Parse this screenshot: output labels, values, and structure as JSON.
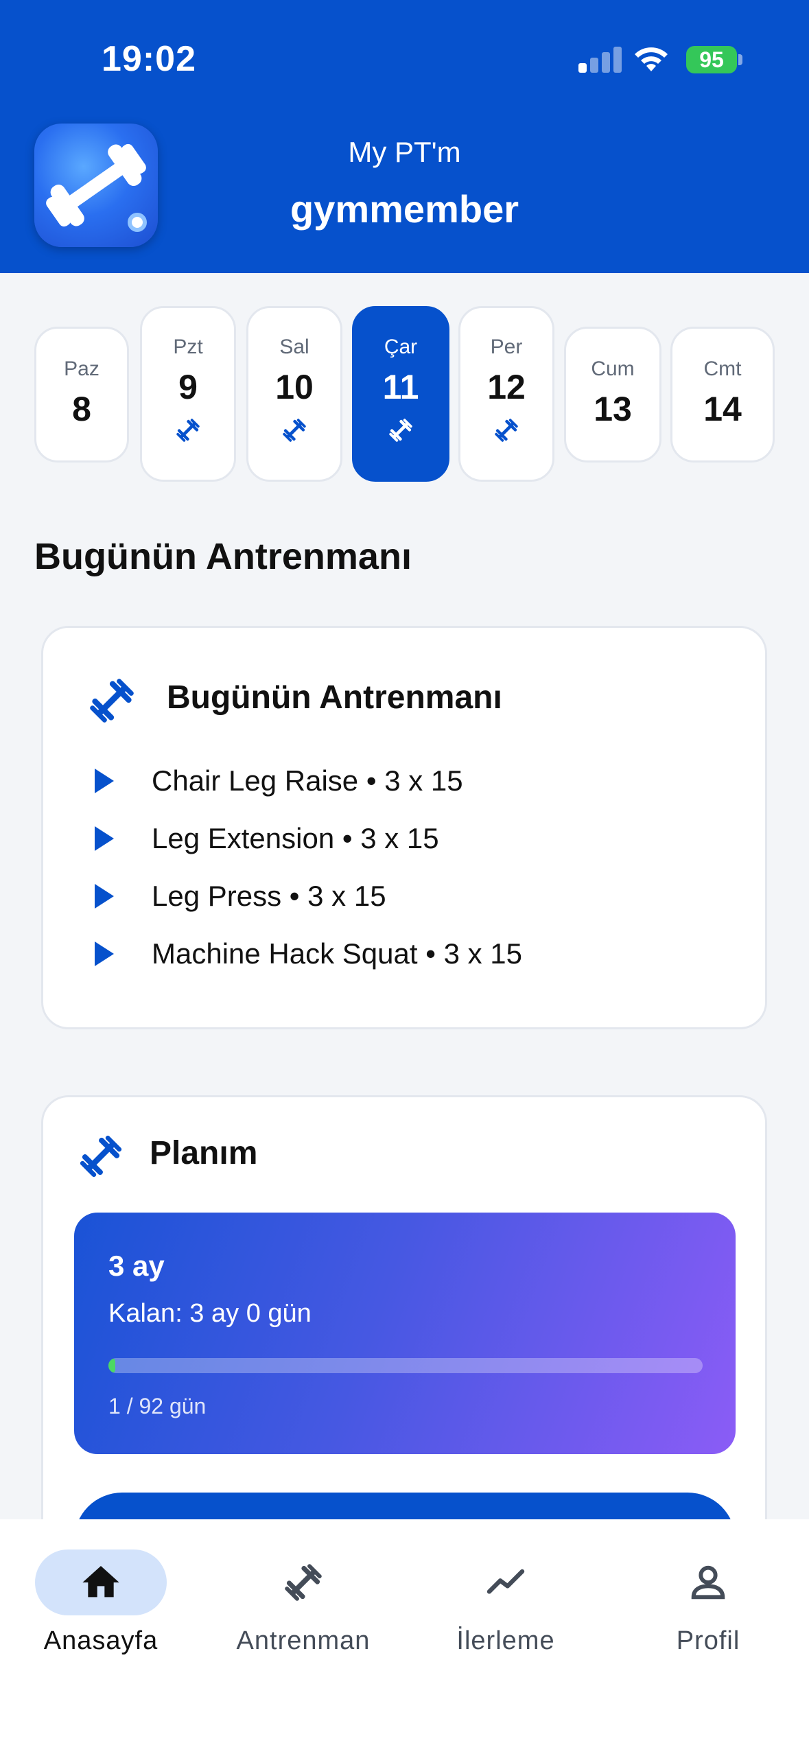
{
  "status_bar": {
    "time": "19:02",
    "battery": "95"
  },
  "header": {
    "app_title": "My PT'm",
    "username": "gymmember"
  },
  "days": [
    {
      "name": "Paz",
      "number": "8",
      "has_workout": false,
      "active": false
    },
    {
      "name": "Pzt",
      "number": "9",
      "has_workout": true,
      "active": false
    },
    {
      "name": "Sal",
      "number": "10",
      "has_workout": true,
      "active": false
    },
    {
      "name": "Çar",
      "number": "11",
      "has_workout": true,
      "active": true
    },
    {
      "name": "Per",
      "number": "12",
      "has_workout": true,
      "active": false
    },
    {
      "name": "Cum",
      "number": "13",
      "has_workout": false,
      "active": false
    },
    {
      "name": "Cmt",
      "number": "14",
      "has_workout": false,
      "active": false
    }
  ],
  "section_title": "Bugünün Antrenmanı",
  "today_card": {
    "title": "Bugünün Antrenmanı",
    "icon": "dumbbell-icon",
    "items": [
      "Chair Leg Raise • 3 x 15",
      "Leg Extension • 3 x 15",
      "Leg Press • 3 x 15",
      "Machine Hack Squat • 3 x 15"
    ]
  },
  "plan_card": {
    "title": "Planım",
    "icon": "dumbbell-icon",
    "plan_name": "3 ay",
    "remaining": "Kalan: 3 ay 0 gün",
    "progress_fraction": 0.011,
    "days_label": "1 / 92 gün"
  },
  "bottom_nav": [
    {
      "label": "Anasayfa",
      "icon": "home-icon",
      "active": true
    },
    {
      "label": "Antrenman",
      "icon": "dumbbell-icon",
      "active": false
    },
    {
      "label": "İlerleme",
      "icon": "trend-icon",
      "active": false
    },
    {
      "label": "Profil",
      "icon": "person-icon",
      "active": false
    }
  ],
  "colors": {
    "primary": "#0651cc",
    "background": "#f3f5f8",
    "progress": "#4cd964"
  }
}
